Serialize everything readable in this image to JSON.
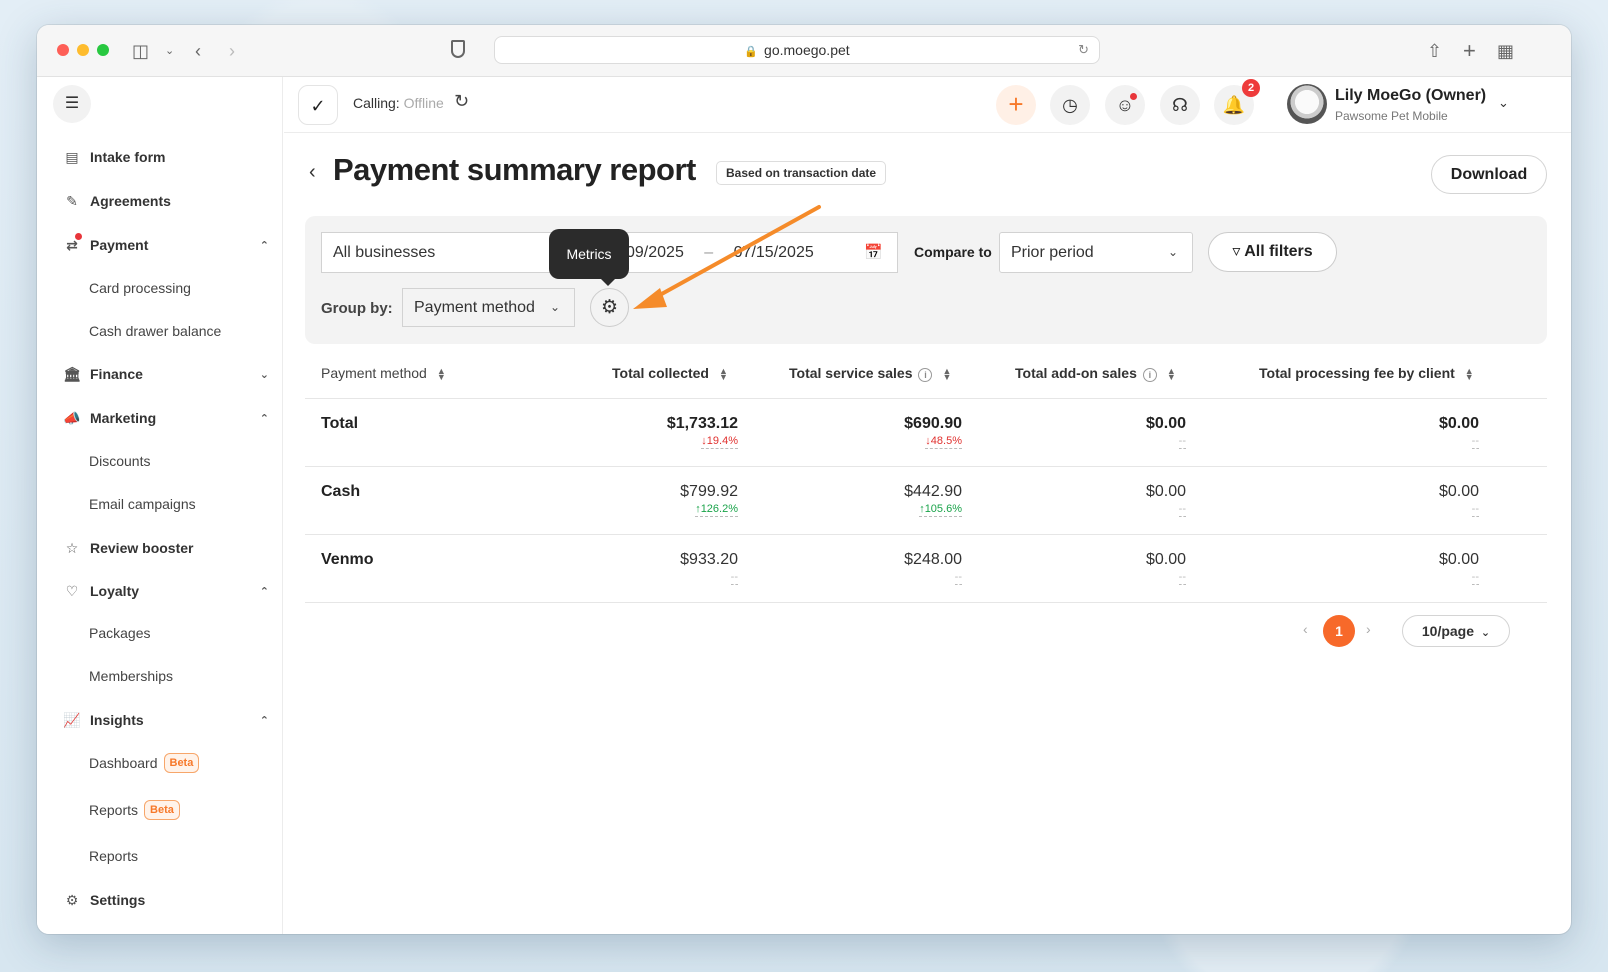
{
  "browser": {
    "url": "go.moego.pet"
  },
  "sidebar": {
    "items": [
      {
        "label": "Intake form"
      },
      {
        "label": "Agreements"
      },
      {
        "label": "Payment"
      },
      {
        "label": "Card processing"
      },
      {
        "label": "Cash drawer balance"
      },
      {
        "label": "Finance"
      },
      {
        "label": "Marketing"
      },
      {
        "label": "Discounts"
      },
      {
        "label": "Email campaigns"
      },
      {
        "label": "Review booster"
      },
      {
        "label": "Loyalty"
      },
      {
        "label": "Packages"
      },
      {
        "label": "Memberships"
      },
      {
        "label": "Insights"
      },
      {
        "label": "Dashboard",
        "badge": "Beta"
      },
      {
        "label": "Reports",
        "badge": "Beta"
      },
      {
        "label": "Reports"
      },
      {
        "label": "Settings"
      }
    ]
  },
  "appbar": {
    "calling_label": "Calling:",
    "calling_status": "Offline",
    "notification_count": "2",
    "user_name": "Lily MoeGo (Owner)",
    "business_name": "Pawsome Pet Mobile"
  },
  "page": {
    "title": "Payment summary report",
    "tag": "Based on transaction date",
    "download_label": "Download"
  },
  "filters": {
    "business": "All businesses",
    "date_start": "09/2025",
    "date_end": "07/15/2025",
    "compare_label": "Compare to",
    "compare_value": "Prior period",
    "all_filters_label": "All filters",
    "group_by_label": "Group by:",
    "group_by_value": "Payment method",
    "tooltip": "Metrics"
  },
  "table": {
    "columns": [
      "Payment method",
      "Total collected",
      "Total service sales",
      "Total add-on sales",
      "Total processing fee by client"
    ],
    "rows": [
      {
        "name": "Total",
        "collected": "$1,733.12",
        "collected_delta": "↓19.4%",
        "service": "$690.90",
        "service_delta": "↓48.5%",
        "addon": "$0.00",
        "addon_delta": "--",
        "fee": "$0.00",
        "fee_delta": "--"
      },
      {
        "name": "Cash",
        "collected": "$799.92",
        "collected_delta": "↑126.2%",
        "service": "$442.90",
        "service_delta": "↑105.6%",
        "addon": "$0.00",
        "addon_delta": "--",
        "fee": "$0.00",
        "fee_delta": "--"
      },
      {
        "name": "Venmo",
        "collected": "$933.20",
        "collected_delta": "--",
        "service": "$248.00",
        "service_delta": "--",
        "addon": "$0.00",
        "addon_delta": "--",
        "fee": "$0.00",
        "fee_delta": "--"
      }
    ]
  },
  "pagination": {
    "current_page": "1",
    "per_page": "10/page"
  },
  "colors": {
    "accent": "#f7692a",
    "negative": "#e0312f",
    "positive": "#1aa34a"
  }
}
